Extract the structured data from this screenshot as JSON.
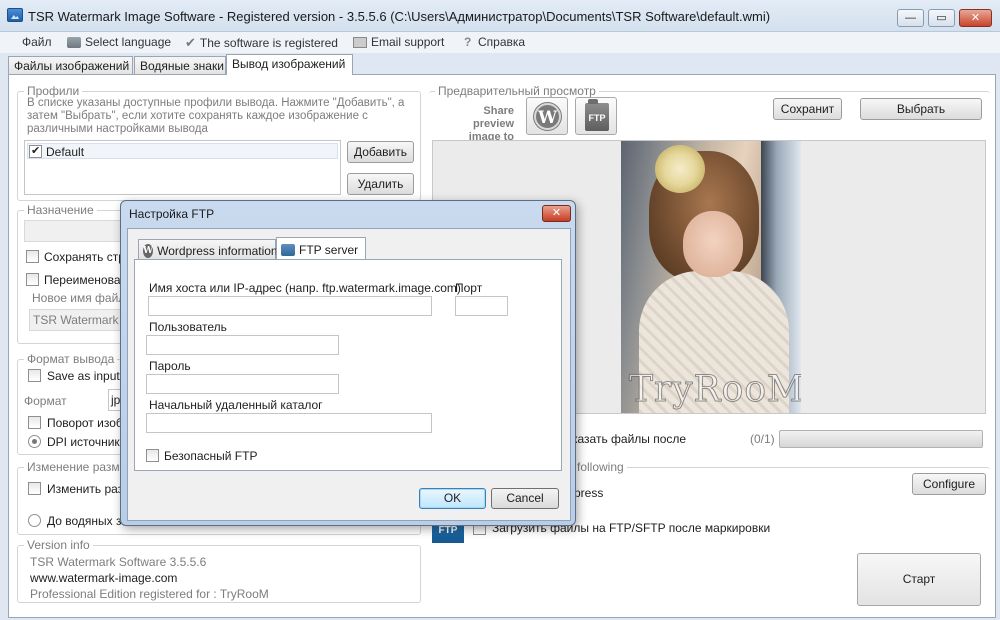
{
  "window": {
    "title": "TSR Watermark Image Software - Registered version - 3.5.5.6 (C:\\Users\\Администратор\\Documents\\TSR Software\\default.wmi)",
    "minimize": "—",
    "maximize": "▭",
    "close": "✕"
  },
  "menu": {
    "file": "Файл",
    "select_language": "Select language",
    "registered": "The software is registered",
    "email_support": "Email support",
    "help": "Справка"
  },
  "tabs": [
    "Файлы изображений",
    "Водяные знаки",
    "Вывод изображений"
  ],
  "profiles": {
    "group_label": "Профили",
    "description": "В списке указаны доступные профили вывода. Нажмите \"Добавить\", а затем \"Выбрать\", если хотите сохранять каждое изображение с различными настройками вывода",
    "items": [
      {
        "name": "Default",
        "checked": true
      }
    ],
    "add_button": "Добавить",
    "delete_button": "Удалить"
  },
  "destination": {
    "group_label": "Назначение",
    "keep_structure": "Сохранять стр",
    "rename": "Переименоват",
    "new_name_label": "Новое имя файл",
    "new_name_value": "TSR Watermark -"
  },
  "output_format": {
    "group_label": "Формат вывода",
    "save_as_input": "Save as input/",
    "format_label": "Формат",
    "format_value": "jp",
    "rotate": "Поворот изоб",
    "dpi_source": "DPI источник"
  },
  "resize": {
    "group_label": "Изменение разме",
    "change": "Изменить раз",
    "to_watermarks": "До водяных зн"
  },
  "version": {
    "group_label": "Version info",
    "line1": "TSR Watermark Software 3.5.5.6",
    "line2": "www.watermark-image.com",
    "line3": "Professional Edition registered for : TryRooM"
  },
  "preview": {
    "group_label": "Предварительный просмотр",
    "share_label_1": "Share preview",
    "share_label_2": "image to",
    "wp_glyph": "W",
    "ftp_glyph": "FTP",
    "save_button": "Сохранит",
    "select_button": "Выбрать",
    "watermark_text": "TryRooM"
  },
  "progress": {
    "show_files_after": "казать файлы после",
    "count": "(0/1)",
    "fraction": 0
  },
  "upload": {
    "following_label": "following",
    "wordpress_text": "press",
    "configure_button": "Configure",
    "ftp_badge": "FTP",
    "ftp_upload_text": "Загрузить файлы на FTP/SFTP после маркировки",
    "start_button": "Старт"
  },
  "dialog": {
    "title": "Настройка FTP",
    "close": "✕",
    "tab_wordpress": "Wordpress information",
    "tab_ftp": "FTP server",
    "host_label": "Имя хоста или IP-адрес (напр. ftp.watermark.image.com)",
    "port_label": "Порт",
    "user_label": "Пользователь",
    "password_label": "Пароль",
    "remote_dir_label": "Начальный удаленный каталог",
    "secure_ftp": "Безопасный FTP",
    "ok_button": "OK",
    "cancel_button": "Cancel"
  }
}
